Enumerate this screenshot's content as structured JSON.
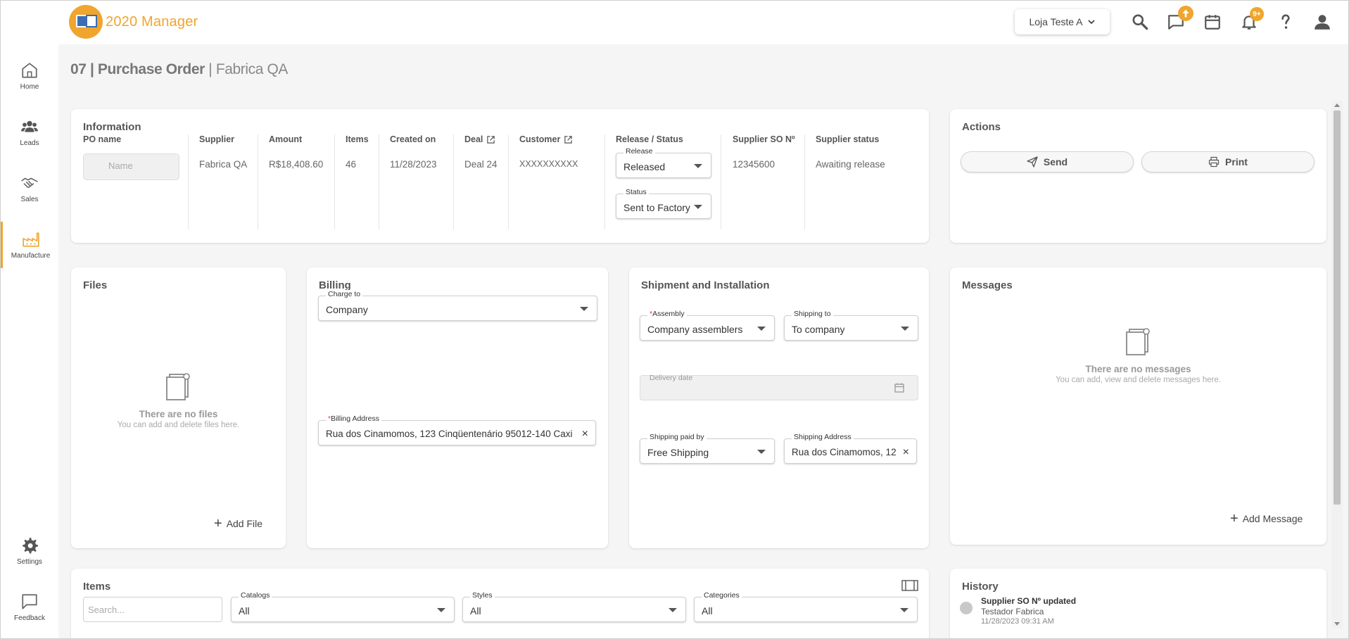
{
  "app": {
    "logo_text": "2020 Manager"
  },
  "header": {
    "store": "Loja Teste A",
    "notifications_badge": "9+"
  },
  "sidebar": {
    "items": [
      {
        "label": "Home",
        "icon": "home-icon"
      },
      {
        "label": "Leads",
        "icon": "people-icon"
      },
      {
        "label": "Sales",
        "icon": "handshake-icon"
      },
      {
        "label": "Manufacture",
        "icon": "factory-icon"
      }
    ],
    "bottom": [
      {
        "label": "Settings",
        "icon": "gear-icon"
      },
      {
        "label": "Feedback",
        "icon": "chat-icon"
      }
    ]
  },
  "page": {
    "title": "07 | Purchase Order",
    "separator": " | ",
    "subtitle": "Fabrica QA"
  },
  "information": {
    "title": "Information",
    "po_name": {
      "header": "PO name",
      "placeholder": "Name"
    },
    "supplier": {
      "header": "Supplier",
      "value": "Fabrica QA"
    },
    "amount": {
      "header": "Amount",
      "value": "R$18,408.60"
    },
    "items": {
      "header": "Items",
      "value": "46"
    },
    "created_on": {
      "header": "Created on",
      "value": "11/28/2023"
    },
    "deal": {
      "header": "Deal",
      "value": "Deal 24"
    },
    "customer": {
      "header": "Customer",
      "value": "XXXXXXXXXX"
    },
    "release_status": {
      "header": "Release / Status",
      "release_label": "Release",
      "release_value": "Released",
      "status_label": "Status",
      "status_value": "Sent to Factory"
    },
    "supplier_so": {
      "header": "Supplier SO Nº",
      "value": "12345600"
    },
    "supplier_status": {
      "header": "Supplier status",
      "value": "Awaiting release"
    }
  },
  "actions": {
    "title": "Actions",
    "send": "Send",
    "print": "Print"
  },
  "files": {
    "title": "Files",
    "empty_title": "There are no files",
    "empty_sub": "You can add and delete files here.",
    "add": "Add File"
  },
  "billing": {
    "title": "Billing",
    "charge_to_label": "Charge to",
    "charge_to_value": "Company",
    "address_label": "Billing Address",
    "address_value": "Rua dos Cinamomos, 123 Cinqüentenário 95012-140 Caxi"
  },
  "shipment": {
    "title": "Shipment and Installation",
    "assembly_label": "Assembly",
    "assembly_value": "Company assemblers",
    "shipping_to_label": "Shipping to",
    "shipping_to_value": "To company",
    "delivery_label": "Delivery date",
    "paid_by_label": "Shipping paid by",
    "paid_by_value": "Free Shipping",
    "address_label": "Shipping Address",
    "address_value": "Rua dos Cinamomos, 12"
  },
  "messages": {
    "title": "Messages",
    "empty_title": "There are no messages",
    "empty_sub": "You can add, view and delete messages here.",
    "add": "Add Message"
  },
  "items_section": {
    "title": "Items",
    "search_placeholder": "Search...",
    "catalogs_label": "Catalogs",
    "catalogs_value": "All",
    "styles_label": "Styles",
    "styles_value": "All",
    "categories_label": "Categories",
    "categories_value": "All"
  },
  "history": {
    "title": "History",
    "entries": [
      {
        "title": "Supplier SO Nº updated",
        "user": "Testador Fabrica",
        "time": "11/28/2023 09:31 AM"
      }
    ]
  },
  "colors": {
    "accent": "#f0a52e",
    "brand_blue": "#3b6db3"
  }
}
